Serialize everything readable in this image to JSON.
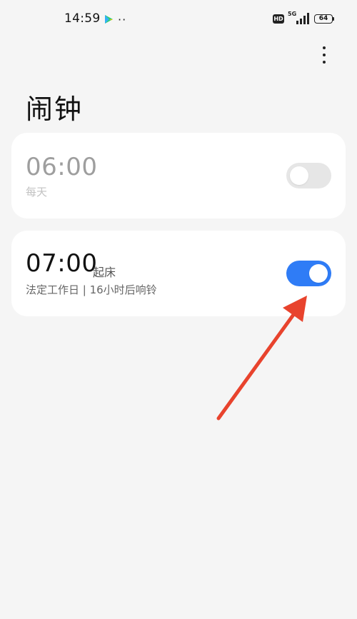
{
  "status_bar": {
    "time": "14:59",
    "more_notifications": "··",
    "hd_label": "HD",
    "network_label": "5G",
    "battery": "64"
  },
  "header": {
    "title": "闹钟"
  },
  "alarms": [
    {
      "time": "06:00",
      "label": "",
      "subtitle": "每天",
      "enabled": false
    },
    {
      "time": "07:00",
      "label": "起床",
      "subtitle": "法定工作日 | 16小时后响铃",
      "enabled": true
    }
  ],
  "colors": {
    "background": "#f5f5f5",
    "card": "#ffffff",
    "toggle_on": "#2f7cf6",
    "toggle_off": "#e6e6e6",
    "annotation_arrow": "#e8432d"
  },
  "icons": {
    "menu": "more-vertical-icon",
    "status_app": "play-store-icon",
    "signal": "signal-bars-icon",
    "battery": "battery-icon"
  }
}
